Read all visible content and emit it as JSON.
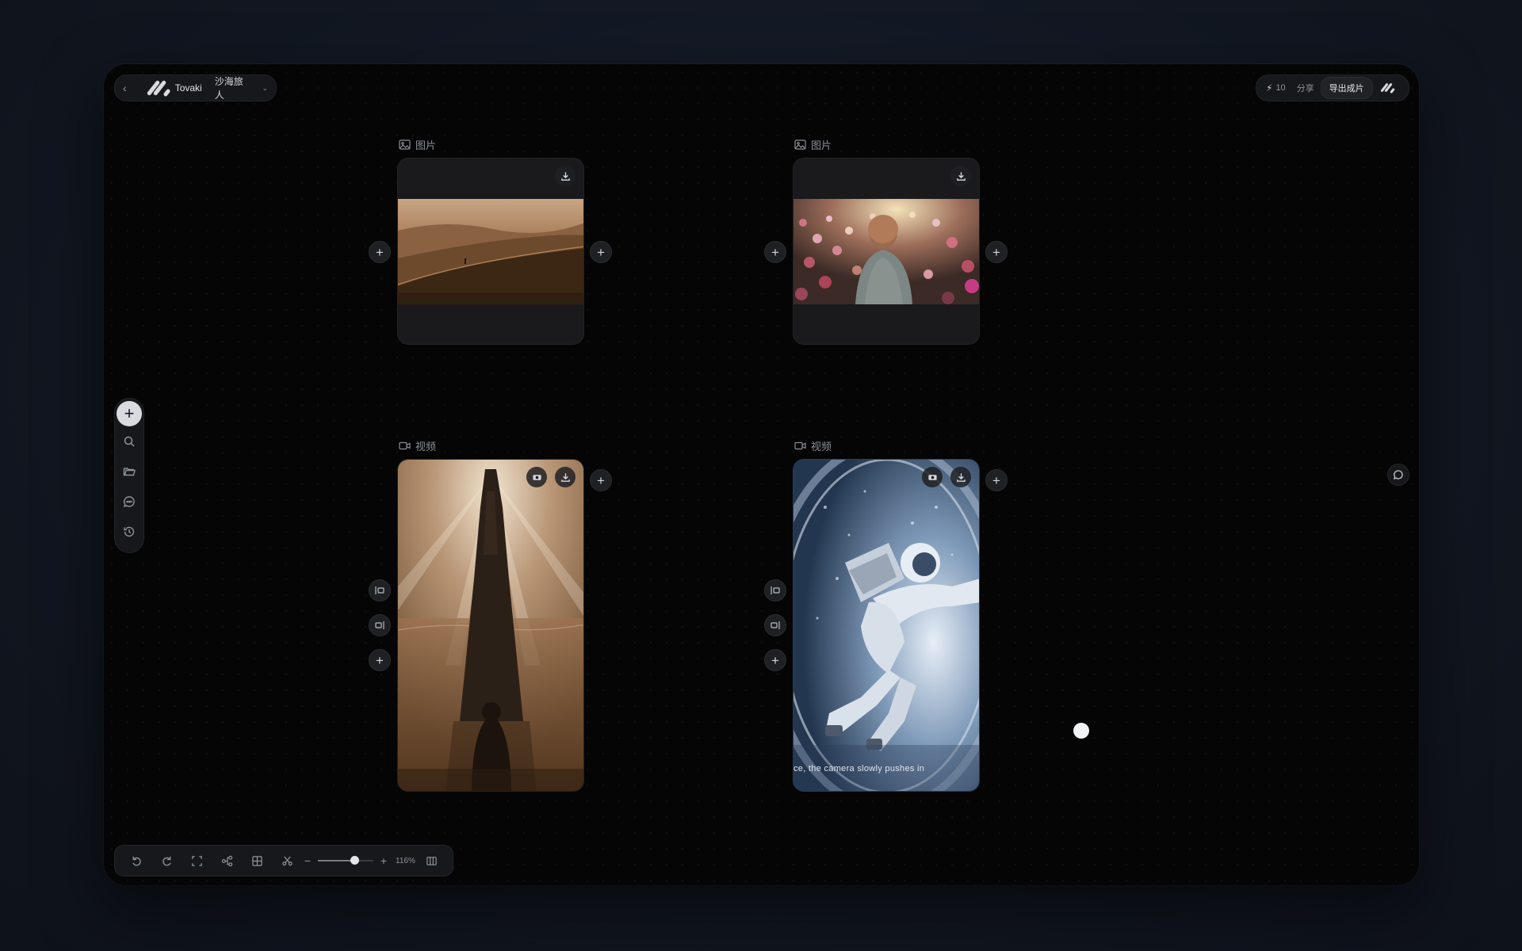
{
  "header": {
    "brand": "Tovaki",
    "project_name": "沙海旅人",
    "credits": "10",
    "share_label": "分享",
    "export_label": "导出成片"
  },
  "nodes": {
    "image_1": {
      "label": "图片"
    },
    "image_2": {
      "label": "图片"
    },
    "video_1": {
      "label": "视频"
    },
    "video_2": {
      "label": "视频",
      "caption": "ce, the camera slowly pushes in"
    }
  },
  "sidebar": {
    "items": [
      {
        "icon": "plus-icon"
      },
      {
        "icon": "search-icon"
      },
      {
        "icon": "folder-icon"
      },
      {
        "icon": "chat-icon"
      },
      {
        "icon": "history-icon"
      }
    ]
  },
  "toolbar": {
    "zoom_label": "116%",
    "zoom_fraction": 0.66,
    "icons": [
      "undo-icon",
      "redo-icon",
      "fullscreen-icon",
      "workflow-icon",
      "grid-icon",
      "scissors-icon",
      "minimap-icon"
    ]
  },
  "colors": {
    "canvas_bg": "#050506",
    "panel_bg": "#17181b",
    "accent": "#d9dbe0"
  }
}
